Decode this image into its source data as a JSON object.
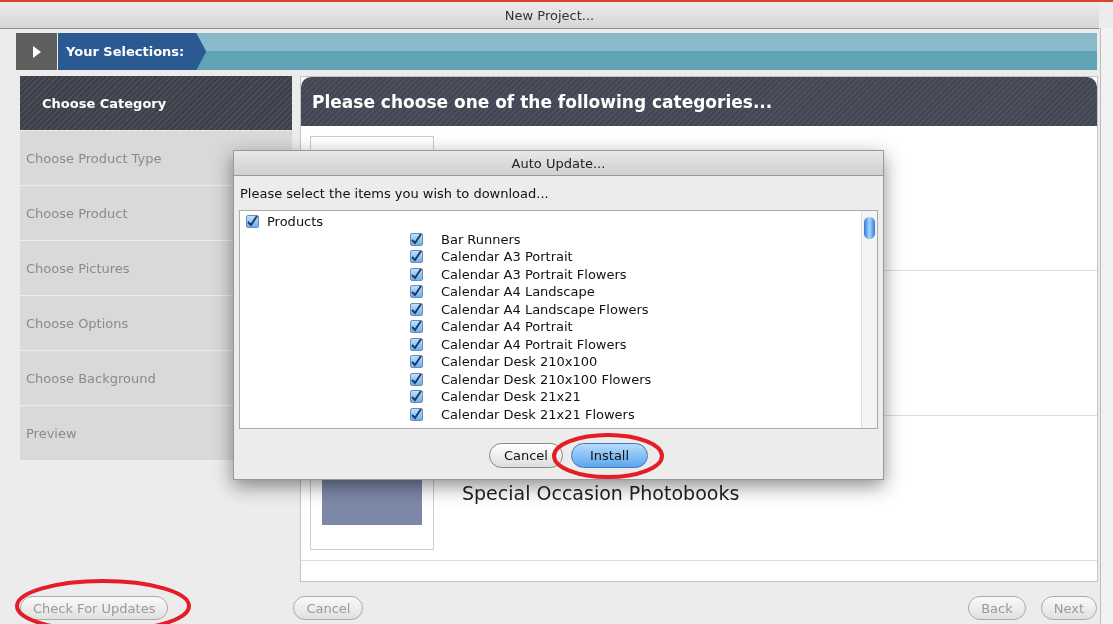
{
  "window": {
    "title": "New Project..."
  },
  "selections_bar": {
    "label": "Your Selections:"
  },
  "steps": [
    {
      "label": "Choose Category",
      "selected": true
    },
    {
      "label": "Choose Product Type",
      "selected": false
    },
    {
      "label": "Choose Product",
      "selected": false
    },
    {
      "label": "Choose Pictures",
      "selected": false
    },
    {
      "label": "Choose Options",
      "selected": false
    },
    {
      "label": "Choose Background",
      "selected": false
    },
    {
      "label": "Preview",
      "selected": false
    }
  ],
  "panel": {
    "title": "Please choose one of the following categories...",
    "categories": [
      {
        "title": "Special Occasion Photobooks"
      }
    ]
  },
  "dialog": {
    "title": "Auto Update...",
    "prompt": "Please select the items you wish to download...",
    "tree": [
      {
        "label": "Products",
        "checked": true,
        "children": [
          {
            "label": "Bar Runners",
            "checked": true
          },
          {
            "label": "Calendar A3 Portrait",
            "checked": true
          },
          {
            "label": "Calendar A3 Portrait Flowers",
            "checked": true
          },
          {
            "label": "Calendar A4 Landscape",
            "checked": true
          },
          {
            "label": "Calendar A4 Landscape Flowers",
            "checked": true
          },
          {
            "label": "Calendar A4 Portrait",
            "checked": true
          },
          {
            "label": "Calendar A4 Portrait Flowers",
            "checked": true
          },
          {
            "label": "Calendar Desk 210x100",
            "checked": true
          },
          {
            "label": "Calendar Desk 210x100 Flowers",
            "checked": true
          },
          {
            "label": "Calendar Desk 21x21",
            "checked": true
          },
          {
            "label": "Calendar Desk 21x21 Flowers",
            "checked": true
          }
        ]
      }
    ],
    "buttons": [
      {
        "label": "Cancel",
        "default": false
      },
      {
        "label": "Install",
        "default": true
      }
    ]
  },
  "footer": {
    "left_button": "Check For Updates",
    "cancel": "Cancel",
    "back": "Back",
    "next": "Next"
  }
}
